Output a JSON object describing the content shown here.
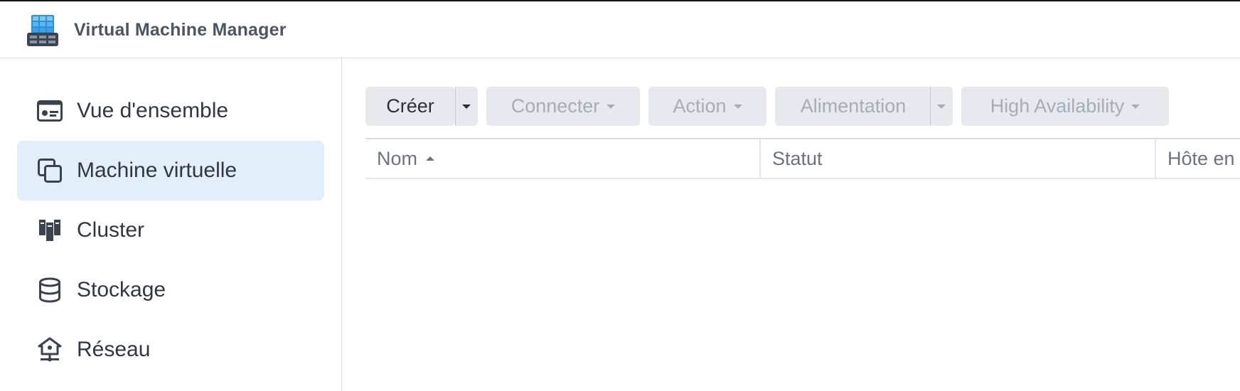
{
  "app": {
    "title": "Virtual Machine Manager",
    "icon": "vmm-app-icon"
  },
  "sidebar": {
    "items": [
      {
        "label": "Vue d'ensemble",
        "icon": "overview-icon",
        "active": false
      },
      {
        "label": "Machine virtuelle",
        "icon": "virtual-machine-icon",
        "active": true
      },
      {
        "label": "Cluster",
        "icon": "cluster-icon",
        "active": false
      },
      {
        "label": "Stockage",
        "icon": "storage-icon",
        "active": false
      },
      {
        "label": "Réseau",
        "icon": "network-icon",
        "active": false
      }
    ]
  },
  "toolbar": {
    "create_label": "Créer",
    "connect_label": "Connecter",
    "action_label": "Action",
    "power_label": "Alimentation",
    "ha_label": "High Availability"
  },
  "table": {
    "columns": [
      {
        "label": "Nom",
        "sorted": "asc"
      },
      {
        "label": "Statut"
      },
      {
        "label": "Hôte en"
      }
    ]
  },
  "colors": {
    "active_nav_bg": "#e3eefb",
    "button_bg": "#e6e9ee",
    "disabled_text": "#a6adb8"
  }
}
